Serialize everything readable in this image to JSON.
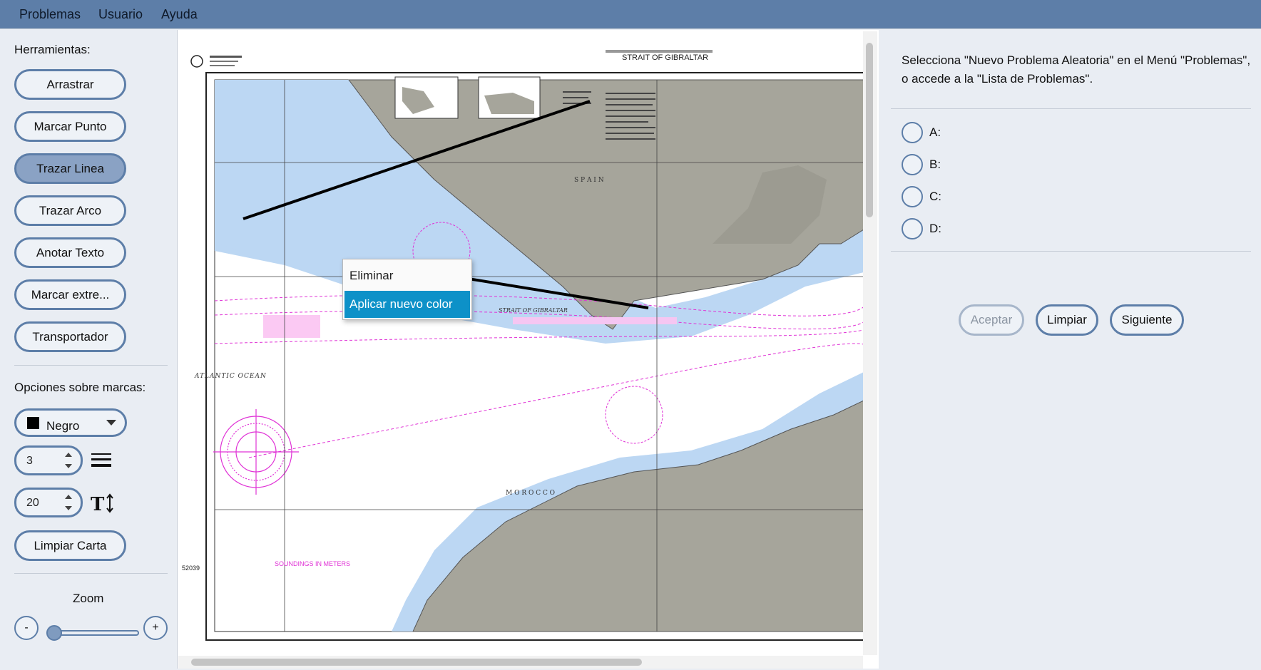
{
  "menubar": {
    "items": [
      "Problemas",
      "Usuario",
      "Ayuda"
    ]
  },
  "tools": {
    "header": "Herramientas:",
    "buttons": [
      "Arrastrar",
      "Marcar Punto",
      "Trazar Linea",
      "Trazar Arco",
      "Anotar Texto",
      "Marcar extre...",
      "Transportador"
    ],
    "active": "Trazar Linea"
  },
  "marks": {
    "header": "Opciones sobre marcas:",
    "color_label": "Negro",
    "color_value": "#000000",
    "line_width": "3",
    "font_size": "20",
    "clear_label": "Limpiar Carta"
  },
  "zoom": {
    "label": "Zoom",
    "minus": "-",
    "plus": "+",
    "level": 0.05
  },
  "map": {
    "chart_number": "52039",
    "title": "STRAIT OF GIBRALTAR",
    "soundings": "SOUNDINGS IN METERS",
    "labels": {
      "ocean": "ATLANTIC OCEAN",
      "spain": "S P A I N",
      "morocco": "M O R O C C O",
      "strait": "STRAIT OF GIBRALTAR"
    },
    "colors": {
      "water_shallow": "#bcd7f3",
      "land": "#a6a59b",
      "magenta": "#e033d6",
      "line": "#000000"
    }
  },
  "context_menu": {
    "items": [
      "Eliminar",
      "Aplicar nuevo color"
    ],
    "selected": "Aplicar nuevo color"
  },
  "problem": {
    "prompt": "Selecciona \"Nuevo Problema Aleatoria\" en el Menú \"Problemas\", o accede a la \"Lista de Problemas\".",
    "options": [
      "A:",
      "B:",
      "C:",
      "D:"
    ]
  },
  "actions": {
    "accept": "Aceptar",
    "clear": "Limpiar",
    "next": "Siguiente"
  }
}
